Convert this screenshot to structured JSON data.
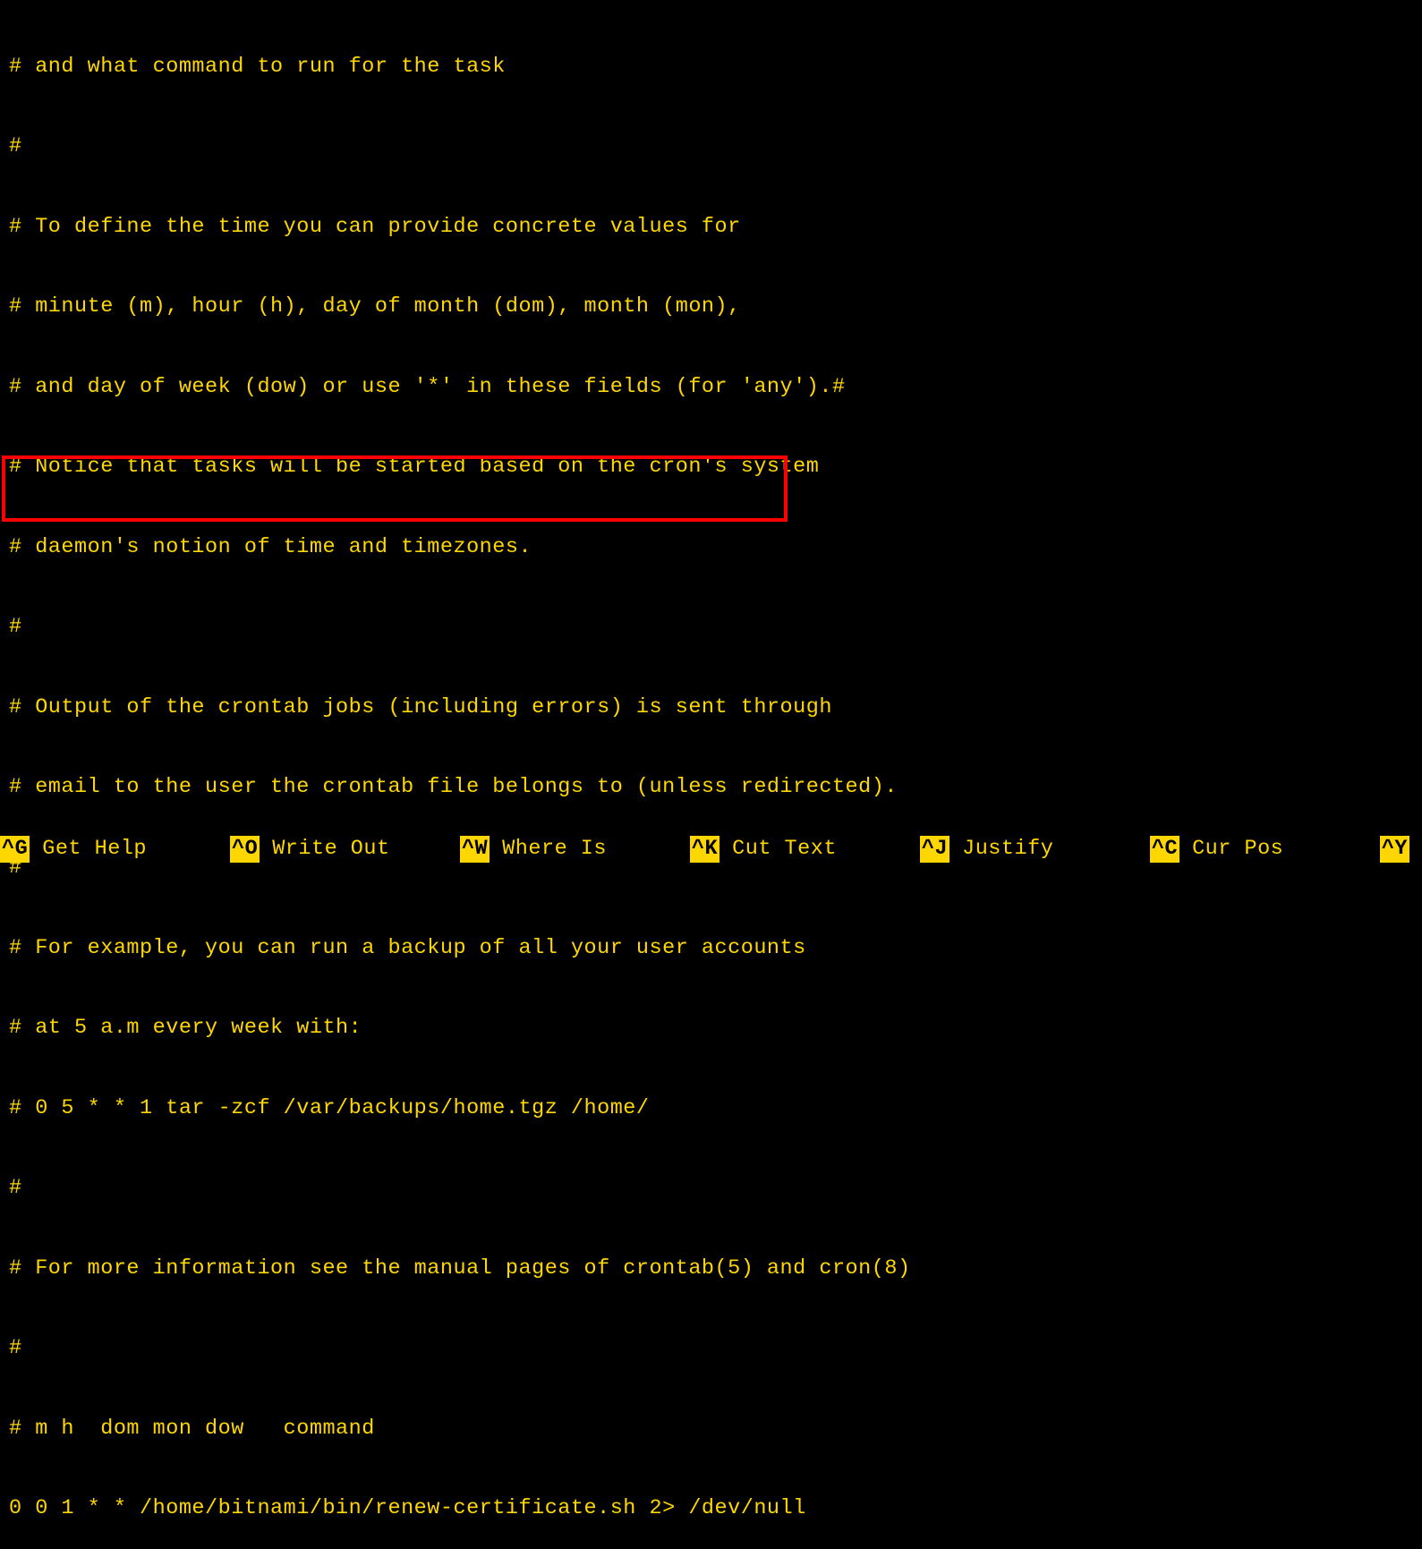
{
  "lines": [
    "# and what command to run for the task",
    "#",
    "# To define the time you can provide concrete values for",
    "# minute (m), hour (h), day of month (dom), month (mon),",
    "# and day of week (dow) or use '*' in these fields (for 'any').#",
    "# Notice that tasks will be started based on the cron's system",
    "# daemon's notion of time and timezones.",
    "#",
    "# Output of the crontab jobs (including errors) is sent through",
    "# email to the user the crontab file belongs to (unless redirected).",
    "#",
    "# For example, you can run a backup of all your user accounts",
    "# at 5 a.m every week with:",
    "# 0 5 * * 1 tar -zcf /var/backups/home.tgz /home/",
    "#",
    "# For more information see the manual pages of crontab(5) and cron(8)",
    "#",
    "# m h  dom mon dow   command",
    "0 0 1 * * /home/bitnami/bin/renew-certificate.sh 2> /dev/null"
  ],
  "footer": [
    {
      "key": "^G",
      "label": "Get Help"
    },
    {
      "key": "^O",
      "label": "Write Out"
    },
    {
      "key": "^W",
      "label": "Where Is"
    },
    {
      "key": "^K",
      "label": "Cut Text"
    },
    {
      "key": "^J",
      "label": "Justify"
    },
    {
      "key": "^C",
      "label": "Cur Pos"
    },
    {
      "key": "^Y",
      "label": ""
    }
  ]
}
